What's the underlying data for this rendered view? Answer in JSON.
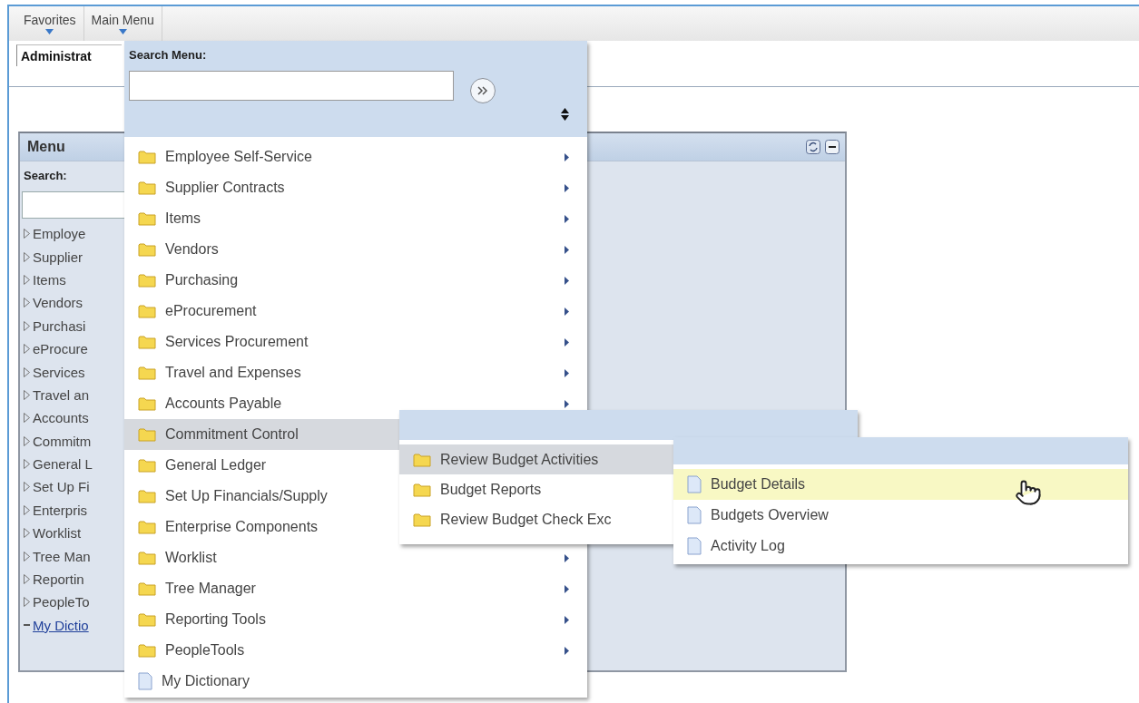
{
  "top_nav": {
    "items": [
      {
        "label": "Favorites"
      },
      {
        "label": "Main Menu"
      }
    ]
  },
  "page_tab": {
    "label": "Administrat"
  },
  "menu_pagelet": {
    "title": "Menu",
    "search_label": "Search:",
    "items": [
      {
        "label": "Employe",
        "kind": "folder"
      },
      {
        "label": "Supplier",
        "kind": "folder"
      },
      {
        "label": "Items",
        "kind": "folder"
      },
      {
        "label": "Vendors",
        "kind": "folder"
      },
      {
        "label": "Purchasi",
        "kind": "folder"
      },
      {
        "label": "eProcure",
        "kind": "folder"
      },
      {
        "label": "Services",
        "kind": "folder"
      },
      {
        "label": "Travel an",
        "kind": "folder"
      },
      {
        "label": "Accounts",
        "kind": "folder"
      },
      {
        "label": "Commitm",
        "kind": "folder"
      },
      {
        "label": "General L",
        "kind": "folder"
      },
      {
        "label": "Set Up Fi",
        "kind": "folder"
      },
      {
        "label": "Enterpris",
        "kind": "folder"
      },
      {
        "label": "Worklist",
        "kind": "folder"
      },
      {
        "label": "Tree Man",
        "kind": "folder"
      },
      {
        "label": "Reportin",
        "kind": "folder"
      },
      {
        "label": "PeopleTo",
        "kind": "folder"
      },
      {
        "label": "My Dictio",
        "kind": "link"
      }
    ]
  },
  "main_menu": {
    "search_label": "Search Menu:",
    "items": [
      {
        "label": "Employee Self-Service",
        "kind": "folder",
        "arrow": true,
        "selected": false
      },
      {
        "label": "Supplier Contracts",
        "kind": "folder",
        "arrow": true,
        "selected": false
      },
      {
        "label": "Items",
        "kind": "folder",
        "arrow": true,
        "selected": false
      },
      {
        "label": "Vendors",
        "kind": "folder",
        "arrow": true,
        "selected": false
      },
      {
        "label": "Purchasing",
        "kind": "folder",
        "arrow": true,
        "selected": false
      },
      {
        "label": "eProcurement",
        "kind": "folder",
        "arrow": true,
        "selected": false
      },
      {
        "label": "Services Procurement",
        "kind": "folder",
        "arrow": true,
        "selected": false
      },
      {
        "label": "Travel and Expenses",
        "kind": "folder",
        "arrow": true,
        "selected": false
      },
      {
        "label": "Accounts Payable",
        "kind": "folder",
        "arrow": true,
        "selected": false
      },
      {
        "label": "Commitment Control",
        "kind": "folder",
        "selected": true
      },
      {
        "label": "General Ledger",
        "kind": "folder",
        "selected": false
      },
      {
        "label": "Set Up Financials/Supply",
        "kind": "folder",
        "selected": false
      },
      {
        "label": "Enterprise Components",
        "kind": "folder",
        "selected": false
      },
      {
        "label": "Worklist",
        "kind": "folder",
        "arrow": true,
        "selected": false
      },
      {
        "label": "Tree Manager",
        "kind": "folder",
        "arrow": true,
        "selected": false
      },
      {
        "label": "Reporting Tools",
        "kind": "folder",
        "arrow": true,
        "selected": false
      },
      {
        "label": "PeopleTools",
        "kind": "folder",
        "arrow": true,
        "selected": false
      },
      {
        "label": "My Dictionary",
        "kind": "page",
        "arrow": false,
        "selected": false
      }
    ]
  },
  "submenu": {
    "items": [
      {
        "label": "Review Budget Activities",
        "kind": "folder",
        "selected": true
      },
      {
        "label": "Budget Reports",
        "kind": "folder",
        "selected": false
      },
      {
        "label": "Review Budget Check Exc",
        "kind": "folder",
        "selected": false
      }
    ]
  },
  "submenu_2": {
    "items": [
      {
        "label": "Budget Details",
        "kind": "page",
        "selected": true
      },
      {
        "label": "Budgets Overview",
        "kind": "page",
        "selected": false
      },
      {
        "label": "Activity Log",
        "kind": "page",
        "selected": false
      }
    ]
  }
}
